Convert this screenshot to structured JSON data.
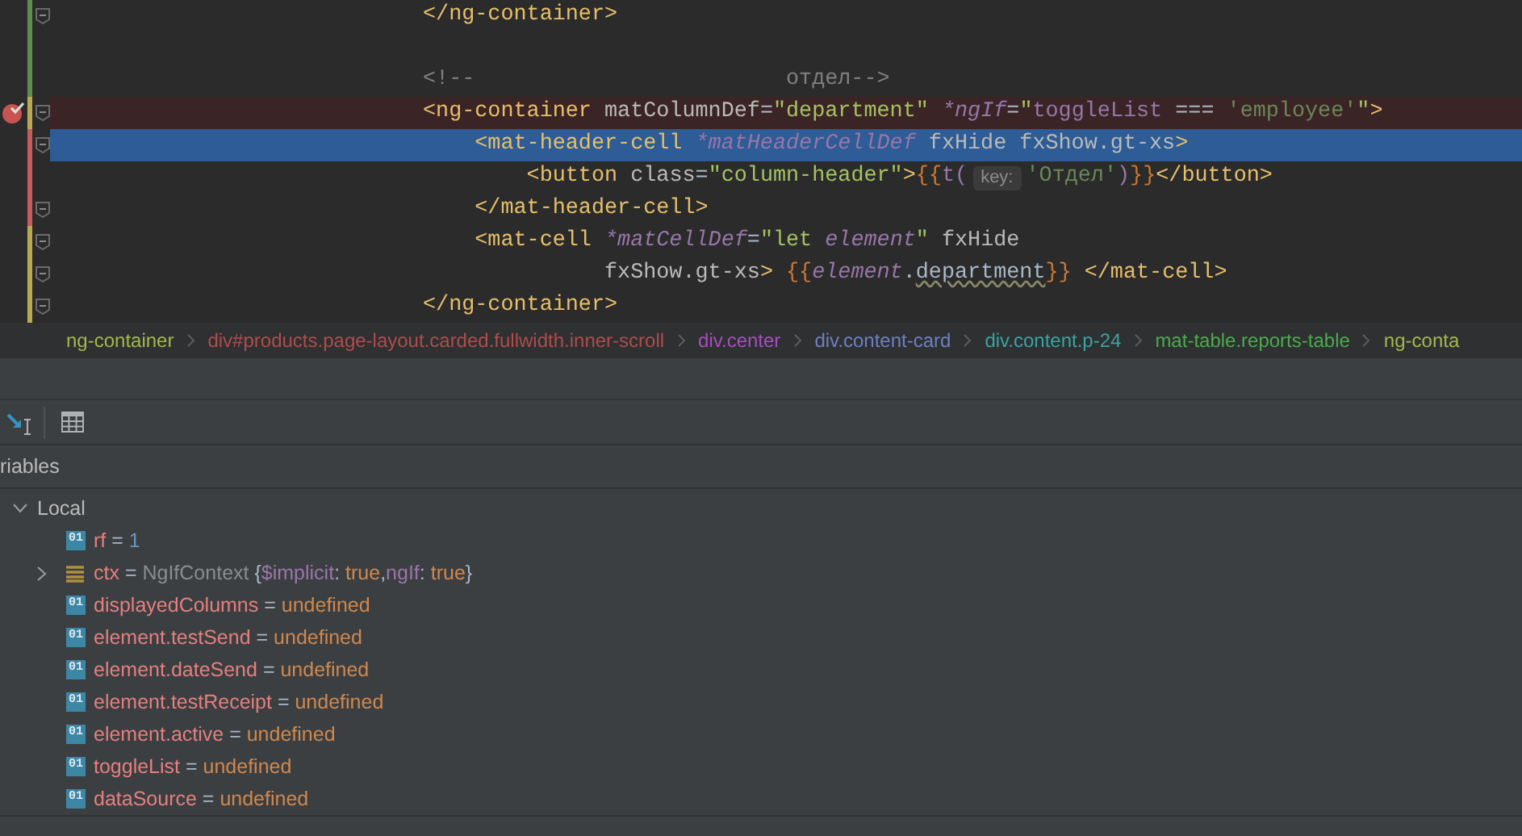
{
  "editor": {
    "lines": [
      {
        "color": "#5e8f4a",
        "fold": true,
        "breakpoint": false,
        "current": false,
        "tokens": [
          {
            "kind": "tag",
            "text": "</ng-container>"
          }
        ]
      },
      {
        "color": "#5e8f4a",
        "fold": false,
        "breakpoint": false,
        "current": false
      },
      {
        "color": "#5e8f4a",
        "fold": false,
        "breakpoint": false,
        "current": false,
        "tokens": [
          {
            "kind": "comment",
            "text": "<!--                        отдел-->"
          }
        ]
      },
      {
        "color": "#b9a951",
        "fold": true,
        "breakpoint": true,
        "current": false,
        "tokens": [
          {
            "kind": "tag",
            "text": "<ng-container"
          },
          {
            "kind": "attr",
            "text": " matColumnDef"
          },
          {
            "kind": "op",
            "text": "="
          },
          {
            "kind": "str",
            "text": "\"department\""
          },
          {
            "kind": "dir",
            "text": " *ngIf"
          },
          {
            "kind": "op",
            "text": "="
          },
          {
            "kind": "str",
            "text": "\""
          },
          {
            "kind": "expr",
            "text": "toggleList"
          },
          {
            "kind": "op",
            "text": " === "
          },
          {
            "kind": "qstr",
            "text": "'employee'"
          },
          {
            "kind": "str",
            "text": "\""
          },
          {
            "kind": "tag",
            "text": ">"
          }
        ]
      },
      {
        "color": "#c45c5c",
        "fold": true,
        "breakpoint": false,
        "current": true,
        "tokens": [
          {
            "kind": "tag",
            "text": "    <mat-header-cell"
          },
          {
            "kind": "dir",
            "text": " *matHeaderCellDef"
          },
          {
            "kind": "attr",
            "text": " fxHide fxShow.gt-xs"
          },
          {
            "kind": "tag",
            "text": ">"
          }
        ]
      },
      {
        "color": "#c45c5c",
        "fold": false,
        "breakpoint": false,
        "current": false,
        "tokens": [
          {
            "kind": "tag",
            "text": "        <button"
          },
          {
            "kind": "attr",
            "text": " class"
          },
          {
            "kind": "op",
            "text": "="
          },
          {
            "kind": "str",
            "text": "\"column-header\""
          },
          {
            "kind": "tag",
            "text": ">"
          },
          {
            "kind": "brace",
            "text": "{{"
          },
          {
            "kind": "fn",
            "text": "t("
          },
          {
            "kind": "hint",
            "text": "key:"
          },
          {
            "kind": "qstr",
            "text": "'Отдел'"
          },
          {
            "kind": "fn",
            "text": ")"
          },
          {
            "kind": "brace",
            "text": "}}"
          },
          {
            "kind": "tag",
            "text": "</button>"
          }
        ]
      },
      {
        "color": "#c45c5c",
        "fold": true,
        "breakpoint": false,
        "current": false,
        "tokens": [
          {
            "kind": "tag",
            "text": "    </mat-header-cell>"
          }
        ]
      },
      {
        "color": "#b9a951",
        "fold": true,
        "breakpoint": false,
        "current": false,
        "tokens": [
          {
            "kind": "tag",
            "text": "    <mat-cell"
          },
          {
            "kind": "dir",
            "text": " *matCellDef"
          },
          {
            "kind": "op",
            "text": "="
          },
          {
            "kind": "str",
            "text": "\"let "
          },
          {
            "kind": "dir",
            "text": "element"
          },
          {
            "kind": "str",
            "text": "\""
          },
          {
            "kind": "attr",
            "text": " fxHide"
          }
        ]
      },
      {
        "color": "#b9a951",
        "fold": true,
        "breakpoint": false,
        "current": false,
        "tokens": [
          {
            "kind": "attr",
            "text": "              fxShow.gt-xs"
          },
          {
            "kind": "tag",
            "text": ">"
          },
          {
            "kind": "brace",
            "text": " {{"
          },
          {
            "kind": "dir",
            "text": "element"
          },
          {
            "kind": "op",
            "text": "."
          },
          {
            "kind": "warn",
            "text": "department"
          },
          {
            "kind": "brace",
            "text": "}}"
          },
          {
            "kind": "tag",
            "text": " </mat-cell>"
          }
        ]
      },
      {
        "color": "#b9a951",
        "fold": true,
        "breakpoint": false,
        "current": false,
        "tokens": [
          {
            "kind": "tag",
            "text": "</ng-container>"
          }
        ]
      }
    ]
  },
  "breadcrumbs": [
    {
      "label": "ng-container",
      "color": "#a3b84a"
    },
    {
      "label": "div#products.page-layout.carded.fullwidth.inner-scroll",
      "color": "#b04c4c"
    },
    {
      "label": "div.center",
      "color": "#a64fbf"
    },
    {
      "label": "div.content-card",
      "color": "#6e80c0"
    },
    {
      "label": "div.content.p-24",
      "color": "#3aa3a0"
    },
    {
      "label": "mat-table.reports-table",
      "color": "#4caa4c"
    },
    {
      "label": "ng-conta",
      "color": "#a3b84a"
    }
  ],
  "variables": {
    "title": "riables",
    "scope": {
      "label": "Local",
      "expanded": true,
      "children": [
        {
          "kind": "primitive",
          "icon": "01",
          "expandable": false,
          "name": "rf",
          "value": [
            {
              "kind": "punct",
              "text": " = "
            },
            {
              "kind": "number",
              "text": "1"
            }
          ]
        },
        {
          "kind": "object",
          "expandable": true,
          "name": "ctx",
          "value": [
            {
              "kind": "punct",
              "text": " = "
            },
            {
              "kind": "type",
              "text": "NgIfContext "
            },
            {
              "kind": "punct",
              "text": "{"
            },
            {
              "kind": "key",
              "text": "$implicit"
            },
            {
              "kind": "punct",
              "text": ": "
            },
            {
              "kind": "literal",
              "text": "true"
            },
            {
              "kind": "punct",
              "text": ","
            },
            {
              "kind": "key",
              "text": "ngIf"
            },
            {
              "kind": "punct",
              "text": ": "
            },
            {
              "kind": "literal",
              "text": "true"
            },
            {
              "kind": "punct",
              "text": "}"
            }
          ]
        },
        {
          "kind": "primitive",
          "icon": "01",
          "expandable": false,
          "name": "displayedColumns",
          "value": [
            {
              "kind": "punct",
              "text": " = "
            },
            {
              "kind": "literal",
              "text": "undefined"
            }
          ]
        },
        {
          "kind": "primitive",
          "icon": "01",
          "expandable": false,
          "name": "element.testSend",
          "value": [
            {
              "kind": "punct",
              "text": " = "
            },
            {
              "kind": "literal",
              "text": "undefined"
            }
          ]
        },
        {
          "kind": "primitive",
          "icon": "01",
          "expandable": false,
          "name": "element.dateSend",
          "value": [
            {
              "kind": "punct",
              "text": " = "
            },
            {
              "kind": "literal",
              "text": "undefined"
            }
          ]
        },
        {
          "kind": "primitive",
          "icon": "01",
          "expandable": false,
          "name": "element.testReceipt",
          "value": [
            {
              "kind": "punct",
              "text": " = "
            },
            {
              "kind": "literal",
              "text": "undefined"
            }
          ]
        },
        {
          "kind": "primitive",
          "icon": "01",
          "expandable": false,
          "name": "element.active",
          "value": [
            {
              "kind": "punct",
              "text": " = "
            },
            {
              "kind": "literal",
              "text": "undefined"
            }
          ]
        },
        {
          "kind": "primitive",
          "icon": "01",
          "expandable": false,
          "name": "toggleList",
          "value": [
            {
              "kind": "punct",
              "text": " = "
            },
            {
              "kind": "literal",
              "text": "undefined"
            }
          ]
        },
        {
          "kind": "primitive",
          "icon": "01",
          "expandable": false,
          "name": "dataSource",
          "value": [
            {
              "kind": "punct",
              "text": " = "
            },
            {
              "kind": "literal",
              "text": "undefined"
            }
          ]
        }
      ]
    }
  }
}
